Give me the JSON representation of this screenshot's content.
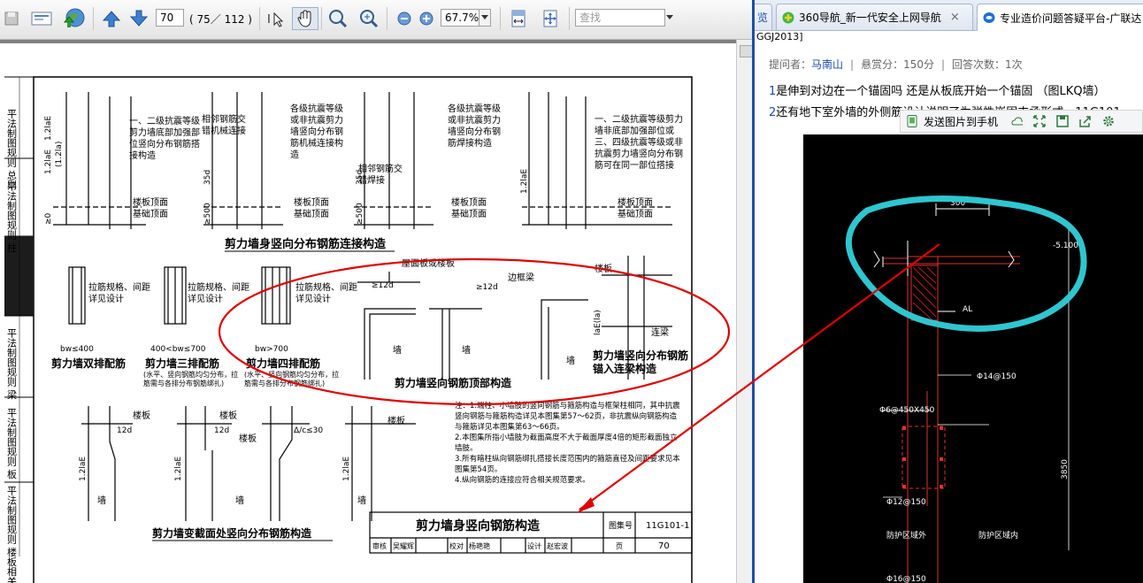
{
  "pdf_viewer": {
    "page_input": "70",
    "page_count": "( 75／ 112 )",
    "zoom": "67.7%",
    "search_placeholder": "查找"
  },
  "drawing": {
    "index_labels": [
      "平法制图规则 总则",
      "平法制图规则 柱",
      "平法制图规则 梁",
      "平法制图规则 板",
      "平法制图规则 楼板相关构造"
    ],
    "splice_notes": [
      "一、二级抗震等级剪力墙底部加强部位竖向分布钢筋搭接构造",
      "相邻钢筋交错机械连接",
      "各级抗震等级或非抗震剪力墙竖向分布钢筋机械连接构造",
      "相邻钢筋交错焊接",
      "各级抗震等级或非抗震剪力墙竖向分布钢筋焊接构造",
      "一、二级抗震等级剪力墙非底部加强部位或三、四级抗震等级或非抗震剪力墙竖向分布钢筋可在同一部位搭接"
    ],
    "slab_top_labels": [
      "楼板顶面",
      "基础顶面"
    ],
    "dims": {
      "lap_a": "1.2laE",
      "lap_b": "(1.2la)",
      "d500": "≥500",
      "d35": "35d",
      "d0": "≥0",
      "d12": "12d",
      "h1": "≥12d",
      "bw400": "bw≤400",
      "bw700": "400<bw≤700",
      "bw_gt700": "bw>700",
      "bw": "bw",
      "lae": "laE(la)",
      "le30": "Δ/c≤30"
    },
    "titles": {
      "vertical_splice": "剪力墙身竖向分布钢筋连接构造",
      "double_row": "剪力墙双排配筋",
      "triple_row": "剪力墙三排配筋",
      "quad_row": "剪力墙四排配筋",
      "top": "剪力墙竖向钢筋顶部构造",
      "into_beam": "剪力墙竖向分布钢筋锚入连梁构造",
      "section_change": "剪力墙变截面处竖向分布钢筋构造",
      "main_title": "剪力墙身竖向钢筋构造"
    },
    "labels": {
      "tie_note": "拉筋规格、间距详见设计",
      "row_note": "(水平、竖向钢筋均匀分布，拉筋需与各排分布钢筋绑扎)",
      "roof_slab": "屋面板或楼板",
      "edge_beam": "边框梁",
      "slab": "楼板",
      "coupling_beam": "连梁",
      "wall": "墙"
    },
    "notes": [
      "注：1.端柱、小墙肢的竖向钢筋与箍筋构造与框架柱相同，其中抗震竖向钢筋与箍筋构造详见本图集第57～62页，非抗震纵向钢筋构造与箍筋详见本图集第63～66页。",
      "2.本图集所指小墙肢为截面高度不大于截面厚度4倍的矩形截面独立墙肢。",
      "3.所有暗柱纵向钢筋绑扎搭接长度范围内的箍筋直径及间距要求见本图集第54页。",
      "4.纵向钢筋的连接应符合相关规范要求。"
    ],
    "title_block": {
      "atlas_label": "图集号",
      "atlas_no": "11G101-1",
      "review": "审核",
      "reviewer": "吴耀辉",
      "check": "校对",
      "checker": "杨艳艳",
      "design": "设计",
      "designer": "赵宏波",
      "page_label": "页",
      "page_no": "70"
    }
  },
  "browser": {
    "tab1_title": "360导航_新一代安全上网导航",
    "tab2_title": "专业造价问题答疑平台-广联达",
    "tab_close": "×",
    "breadcrumb": "GGJ2013]",
    "meta": {
      "asker_label": "提问者：",
      "asker": "马南山",
      "reward": "悬赏分：150分",
      "answers": "回答次数：1次"
    },
    "q1_num": "1",
    "q1_text": "是伸到对边在一个锚固吗  还是从板底开始一个锚固  （图LKQ墙）",
    "q2_num": "2",
    "q2_text": "还有地下室外墙的外侧筋设计说明了为弹性嵌固支承形式，11G101",
    "image_toolbar": {
      "send_label": "发送图片到手机"
    },
    "cad": {
      "dim_300": "300",
      "dim_500": "-5.100",
      "al": "AL",
      "rebar1": "Φ14@150",
      "rebar2": "Φ6@450X450",
      "rebar3": "Φ12@150",
      "rebar4": "Φ16@150",
      "height": "3850",
      "left_label": "防护区域外",
      "right_label": "防护区域内"
    }
  },
  "colors": {
    "annotation_red": "#e00000",
    "highlight_cyan": "#2fc6cf",
    "link_blue": "#1a4aa8"
  }
}
